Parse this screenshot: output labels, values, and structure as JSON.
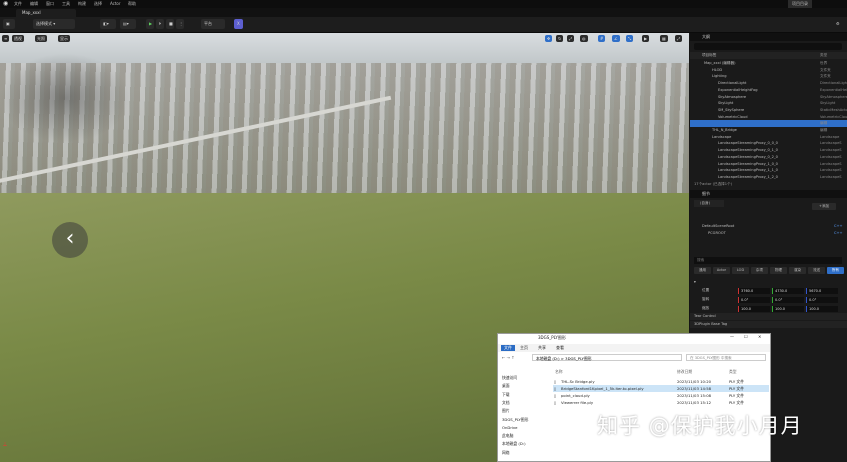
{
  "menu": {
    "items": [
      "文件",
      "编辑",
      "窗口",
      "工具",
      "构建",
      "选择",
      "Actor",
      "帮助"
    ],
    "right": "项目目录"
  },
  "tab": {
    "title": "Map_xxxl"
  },
  "toolbar": {
    "save": "保存",
    "mode": "选择模式",
    "platforms": "平台"
  },
  "viewport": {
    "perspective": "透视",
    "lit": "光照",
    "show": "显示"
  },
  "outliner": {
    "title": "大纲",
    "header_label": "项目标签",
    "header_type": "类型",
    "rows": [
      {
        "name": "Map_xxxl (编辑器)",
        "type": "世界"
      },
      {
        "name": "HLOD",
        "type": "文件夹"
      },
      {
        "name": "Lighting",
        "type": "文件夹"
      },
      {
        "name": "DirectionalLight",
        "type": "DirectionalLight"
      },
      {
        "name": "ExponentialHeightFog",
        "type": "ExponentialHeightFog"
      },
      {
        "name": "SkyAtmosphere",
        "type": "SkyAtmosphere"
      },
      {
        "name": "SkyLight",
        "type": "SkyLight"
      },
      {
        "name": "SM_SkySphere",
        "type": "StaticMeshActor"
      },
      {
        "name": "VolumetricCloud",
        "type": "VolumetricCloud"
      },
      {
        "name": "",
        "type": "编辑"
      },
      {
        "name": "THL_N_Bridge",
        "type": "编辑"
      },
      {
        "name": "Landscape",
        "type": "Landscape"
      },
      {
        "name": "LandscapeStreamingProxy_0_0_0",
        "type": "LandscapeS"
      },
      {
        "name": "LandscapeStreamingProxy_0_1_0",
        "type": "LandscapeS"
      },
      {
        "name": "LandscapeStreamingProxy_0_2_0",
        "type": "LandscapeS"
      },
      {
        "name": "LandscapeStreamingProxy_1_0_0",
        "type": "LandscapeS"
      },
      {
        "name": "LandscapeStreamingProxy_1_1_0",
        "type": "LandscapeS"
      },
      {
        "name": "LandscapeStreamingProxy_1_2_0",
        "type": "LandscapeS"
      }
    ],
    "footer": "17个actor (已选择1个)"
  },
  "details": {
    "title": "细节",
    "add": "+添加",
    "self": "(自身)",
    "components": [
      {
        "name": "DefaultSceneRoot",
        "type": "C++"
      },
      {
        "name": "PCGROOT",
        "type": "C++"
      }
    ],
    "search": "搜索",
    "tabs": [
      "通用",
      "Actor",
      "LOD",
      "杂项",
      "物理",
      "渲染",
      "流送",
      "所有"
    ],
    "transform": {
      "location": {
        "label": "位置",
        "x": "3760.0",
        "y": "4730.0",
        "z": "5670.0"
      },
      "rotation": {
        "label": "旋转",
        "x": "0.0°",
        "y": "0.0°",
        "z": "0.0°"
      },
      "scale": {
        "label": "缩放",
        "x": "100.0",
        "y": "100.0",
        "z": "100.0"
      }
    },
    "sections": [
      "Tear Control",
      "3DPlugin Base Tag"
    ]
  },
  "explorer": {
    "title": "3DGS_PLY图形",
    "tabs": [
      "文件",
      "主页",
      "共享",
      "查看"
    ],
    "path": "本地磁盘 (D:) > 3DGS_PLY图形",
    "search": "在 3DGS_PLY图形 中搜索",
    "columns": [
      "名称",
      "修改日期",
      "类型"
    ],
    "files": [
      {
        "name": "THL-Sc Bridge.ply",
        "date": "2023/11/03 10:20",
        "type": "PLY 文件"
      },
      {
        "name": "BridgeStanford1Kpixel_1_5k.iter.to.pixel.ply",
        "date": "2023/11/03 14:58",
        "type": "PLY 文件"
      },
      {
        "name": "point_cloud.ply",
        "date": "2023/11/03 15:08",
        "type": "PLY 文件"
      },
      {
        "name": "Viewerrer file.ply",
        "date": "2023/11/03 15:12",
        "type": "PLY 文件"
      }
    ],
    "nav": [
      "快速访问",
      "桌面",
      "下载",
      "文档",
      "图片",
      "3DGS_PLY图形",
      "OnDrive",
      "此电脑",
      "本地磁盘 (D:)",
      "网络"
    ]
  },
  "watermark": "知乎 @保护我小月月"
}
